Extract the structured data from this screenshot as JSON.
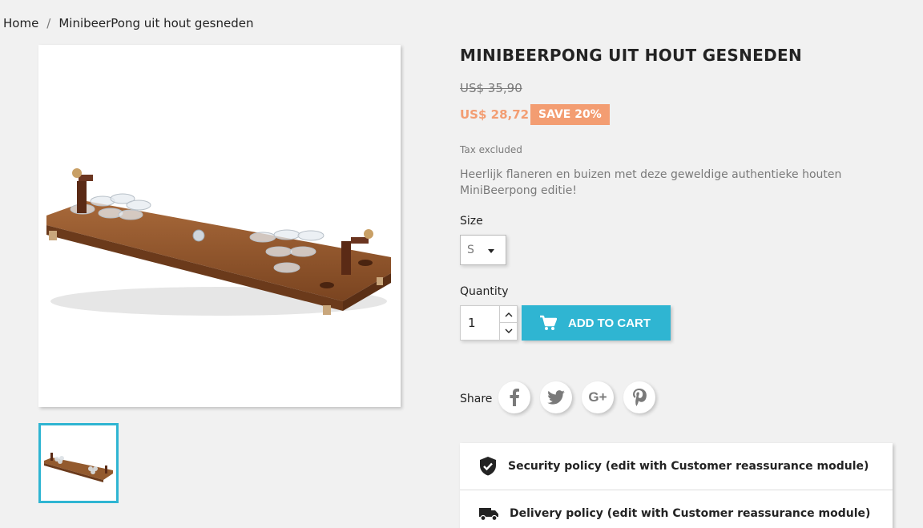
{
  "breadcrumb": {
    "home": "Home",
    "separator": "/",
    "current": "MinibeerPong uit hout gesneden"
  },
  "product": {
    "title": "MINIBEERPONG UIT HOUT GESNEDEN",
    "old_price": "US$ 35,90",
    "new_price": "US$ 28,72",
    "discount_badge": "SAVE 20%",
    "tax_note": "Tax excluded",
    "description": "Heerlijk flaneren en buizen met deze geweldige authentieke houten MiniBeerpong editie!"
  },
  "options": {
    "size_label": "Size",
    "size_value": "S",
    "quantity_label": "Quantity",
    "quantity_value": "1"
  },
  "cart": {
    "add_label": "ADD TO CART"
  },
  "share": {
    "label": "Share",
    "buttons": [
      "facebook-icon",
      "twitter-icon",
      "google-plus-icon",
      "pinterest-icon"
    ]
  },
  "reassurance": {
    "items": [
      {
        "icon": "shield-check-icon",
        "text": "Security policy (edit with Customer reassurance module)"
      },
      {
        "icon": "truck-icon",
        "text": "Delivery policy (edit with Customer reassurance module)"
      }
    ]
  },
  "colors": {
    "accent": "#2fb5d2",
    "discount": "#f39d72",
    "background": "#f1f1f1"
  }
}
